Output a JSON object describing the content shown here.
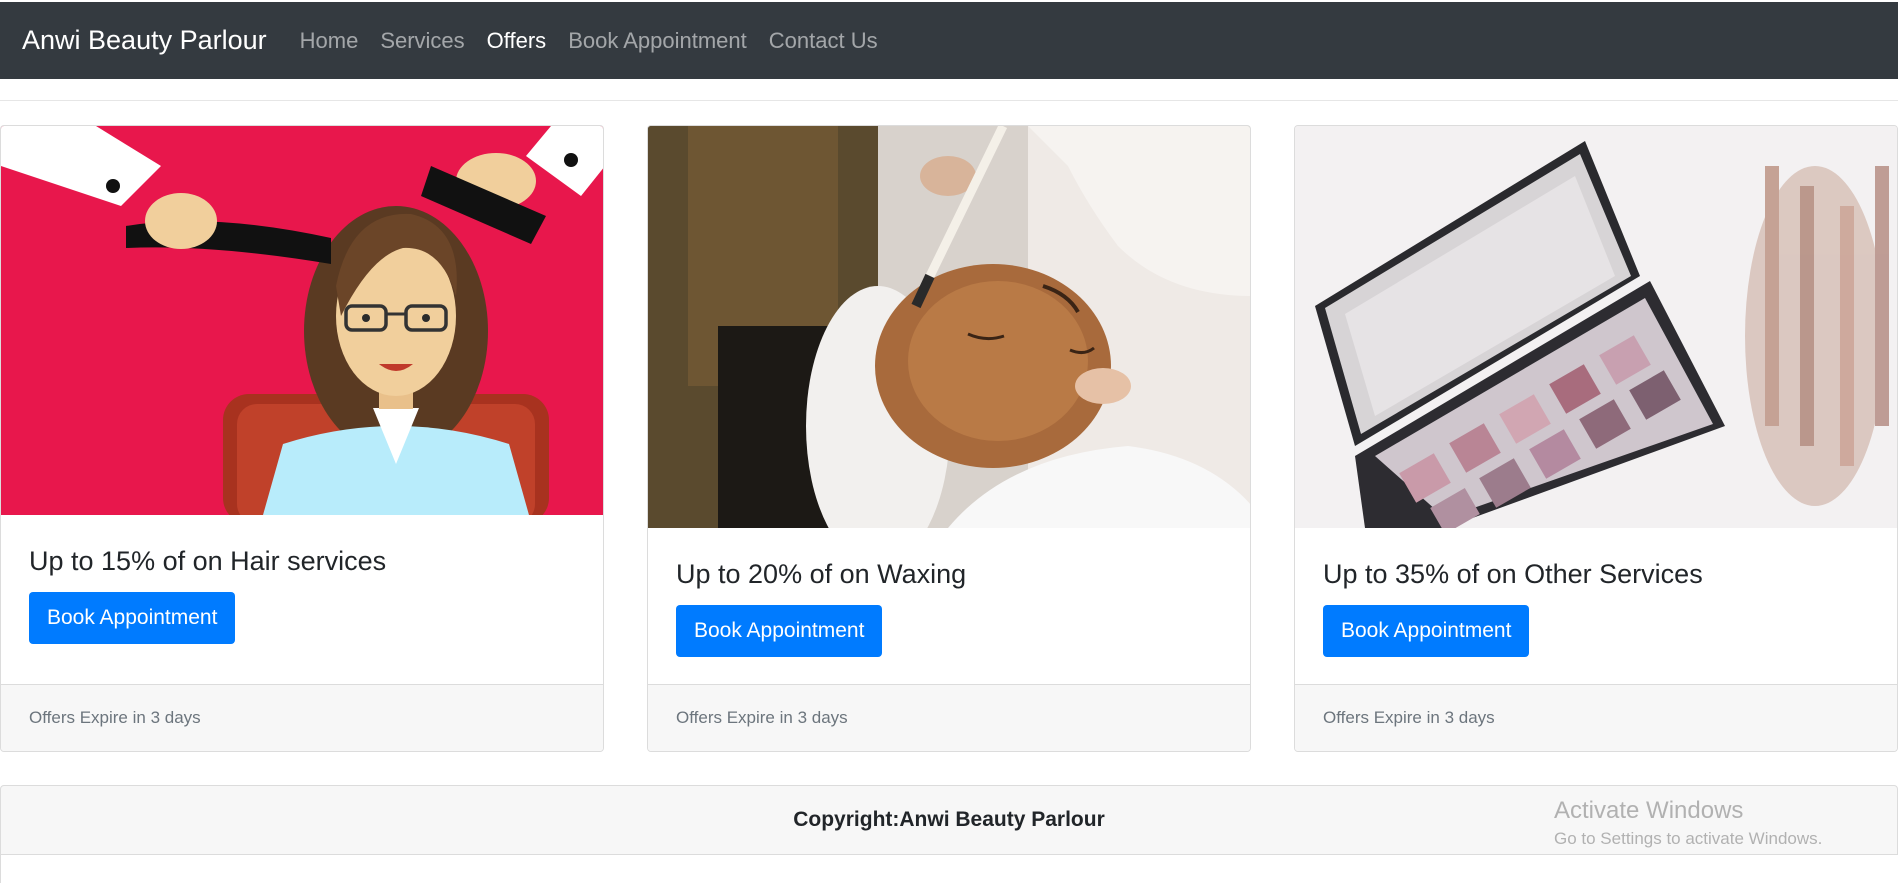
{
  "navbar": {
    "brand": "Anwi Beauty Parlour",
    "links": [
      {
        "label": "Home",
        "active": false
      },
      {
        "label": "Services",
        "active": false
      },
      {
        "label": "Offers",
        "active": true
      },
      {
        "label": "Book Appointment",
        "active": false
      },
      {
        "label": "Contact Us",
        "active": false
      }
    ]
  },
  "offers": [
    {
      "title": "Up to 15% of on Hair services",
      "button": "Book Appointment",
      "footer": "Offers Expire in 3 days",
      "image": "hair-styling-illustration"
    },
    {
      "title": "Up to 20% of on Waxing",
      "button": "Book Appointment",
      "footer": "Offers Expire in 3 days",
      "image": "facial-mask-photo"
    },
    {
      "title": "Up to 35% of on Other Services",
      "button": "Book Appointment",
      "footer": "Offers Expire in 3 days",
      "image": "eyeshadow-palette-photo"
    }
  ],
  "footer": {
    "copyright": "Copyright:Anwi Beauty Parlour"
  },
  "watermark": {
    "line1": "Activate Windows",
    "line2": "Go to Settings to activate Windows."
  },
  "colors": {
    "navbar": "#343a40",
    "primary": "#007bff",
    "card_footer": "#f7f7f7",
    "hair_bg": "#e8174c"
  }
}
